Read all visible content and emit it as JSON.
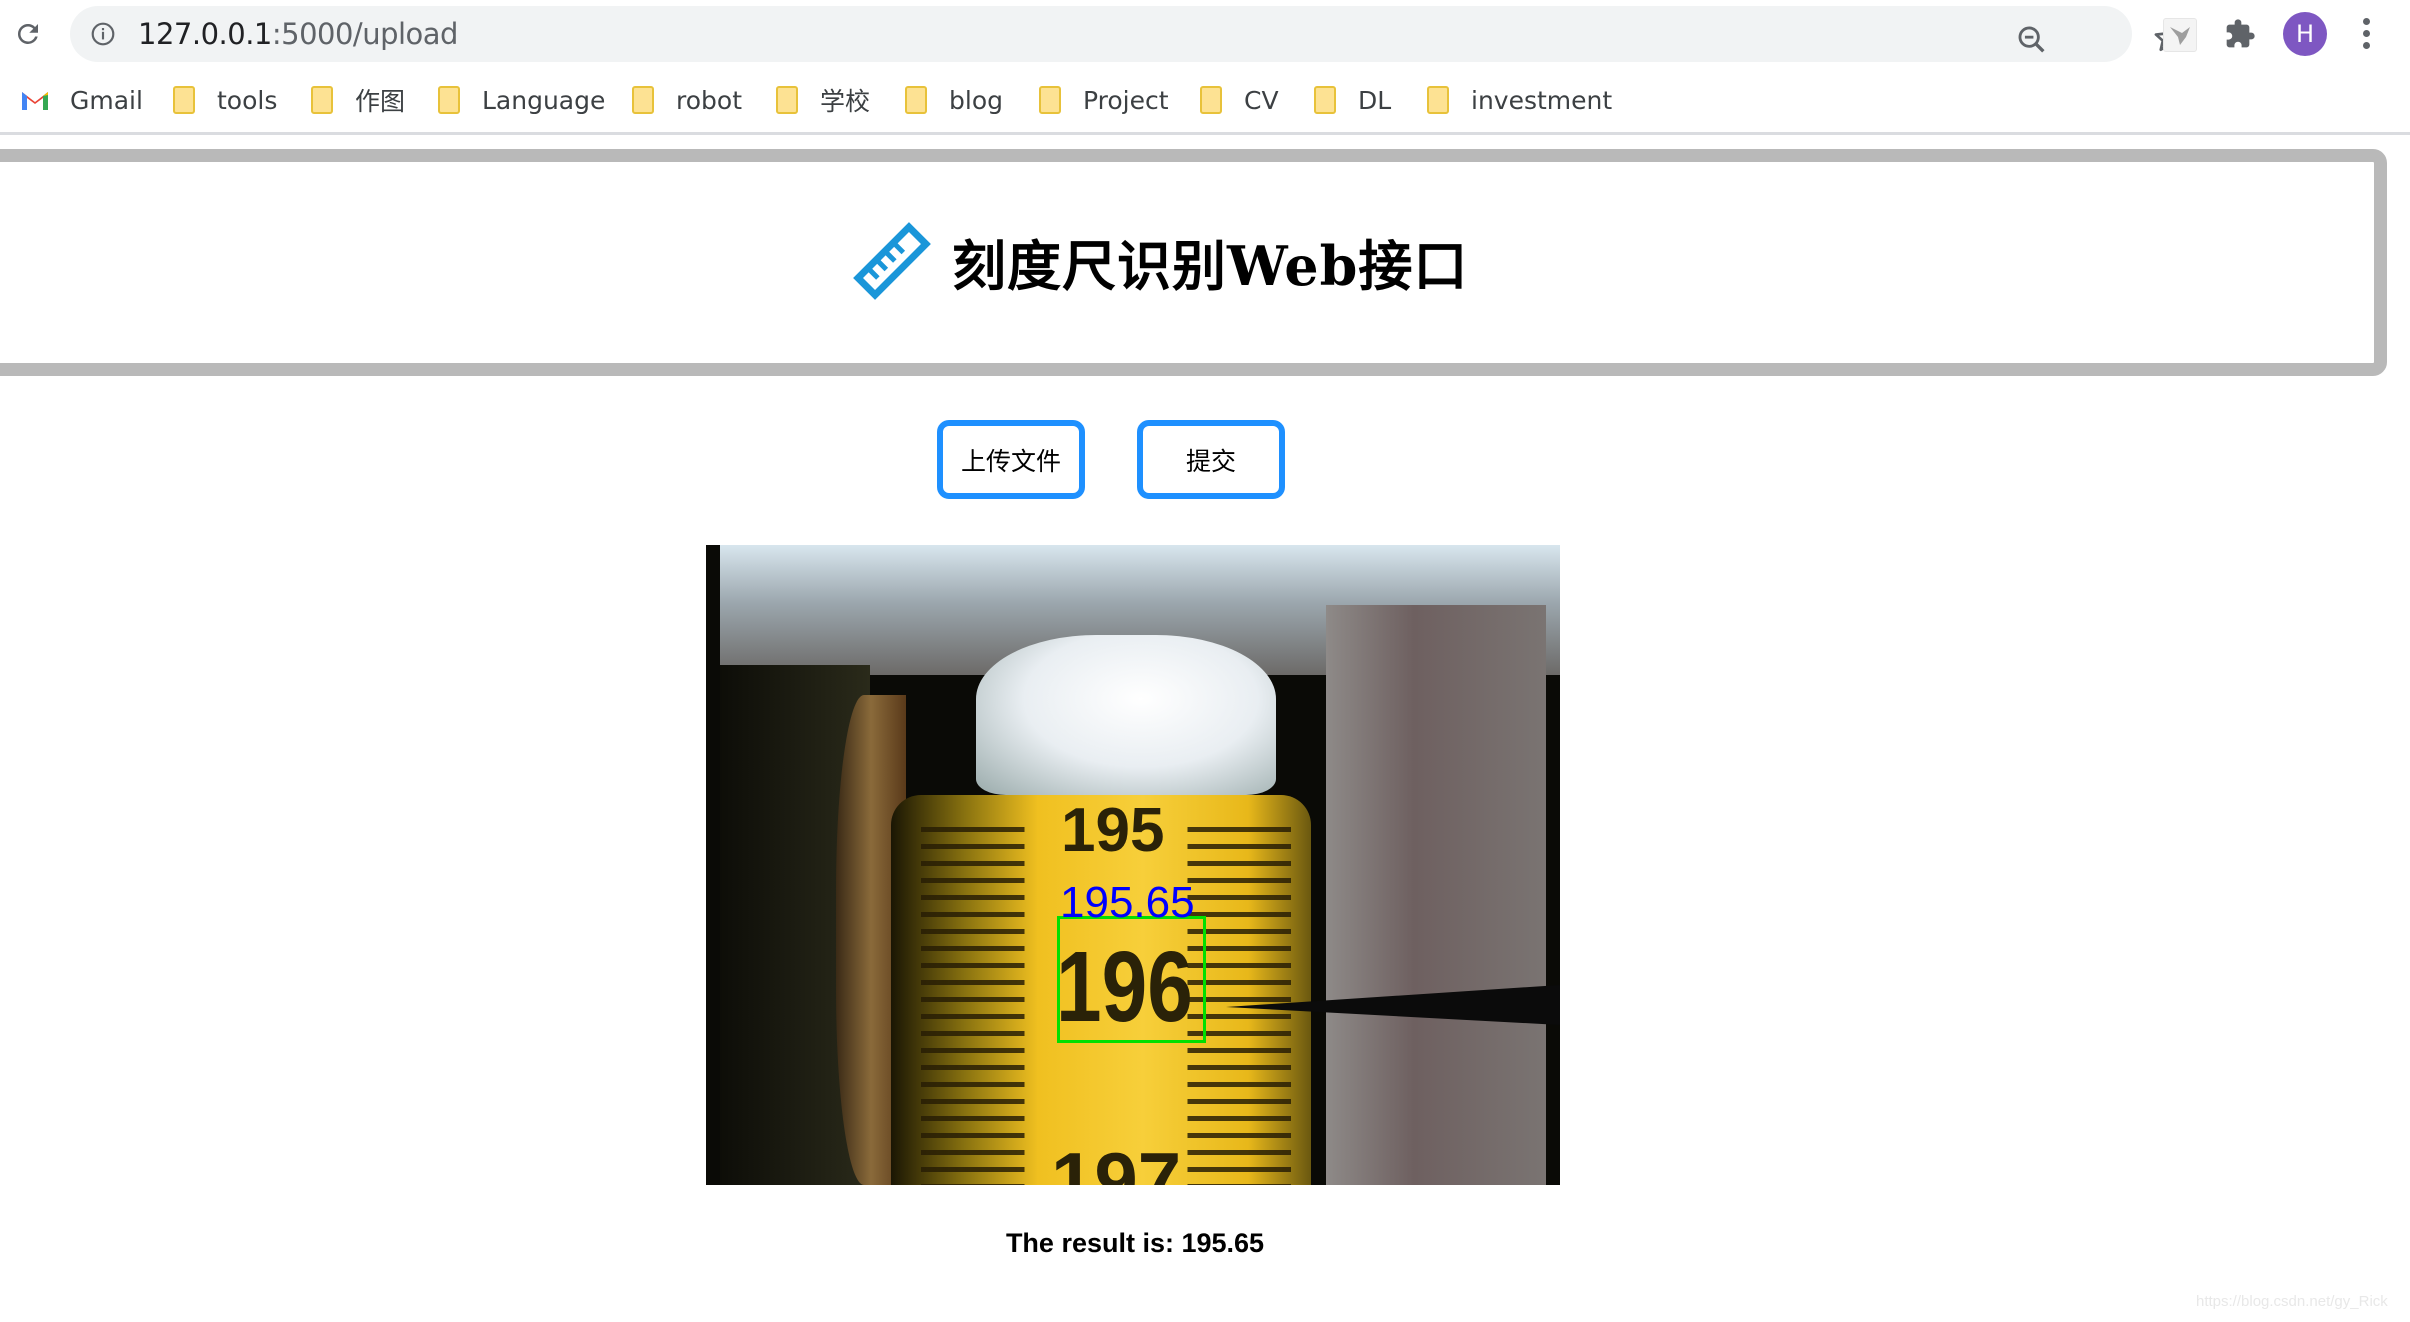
{
  "browser": {
    "url_host": "127.0.0.1",
    "url_path": ":5000/upload",
    "avatar_initial": "H",
    "avatar_color": "#7e57c2",
    "icons": [
      "reload-icon",
      "info-icon",
      "zoom-out-icon",
      "bookmark-star-icon",
      "extension-bird-icon",
      "extensions-puzzle-icon",
      "profile-avatar",
      "menu-icon"
    ]
  },
  "bookmarks": [
    {
      "label": "Gmail",
      "icon": "gmail-icon"
    },
    {
      "label": "tools",
      "icon": "folder-icon"
    },
    {
      "label": "作图",
      "icon": "folder-icon"
    },
    {
      "label": "Language",
      "icon": "folder-icon"
    },
    {
      "label": "robot",
      "icon": "folder-icon"
    },
    {
      "label": "学校",
      "icon": "folder-icon"
    },
    {
      "label": "blog",
      "icon": "folder-icon"
    },
    {
      "label": "Project",
      "icon": "folder-icon"
    },
    {
      "label": "CV",
      "icon": "folder-icon"
    },
    {
      "label": "DL",
      "icon": "folder-icon"
    },
    {
      "label": "investment",
      "icon": "folder-icon"
    }
  ],
  "page": {
    "title": "刻度尺识别Web接口",
    "title_icon": "ruler-icon",
    "accent_color": "#1e90ff",
    "buttons": {
      "upload": "上传文件",
      "submit": "提交"
    },
    "image": {
      "description": "Tape measure photo with detection overlay",
      "scale_numbers": [
        "195",
        "196",
        "197"
      ],
      "detection_label": "195.65",
      "detection_box_color": "#00e000",
      "detection_label_color": "#0000ff"
    },
    "result_text": "The result is: 195.65"
  },
  "watermark": "https://blog.csdn.net/gy_Rick"
}
